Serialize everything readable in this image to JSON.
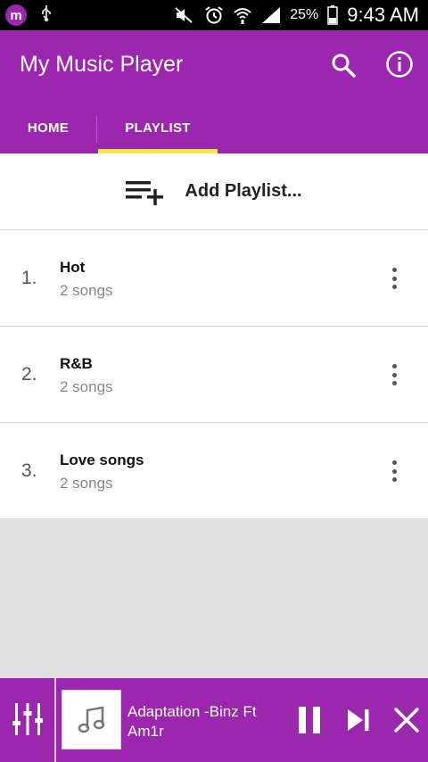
{
  "status_bar": {
    "app_badge": "m",
    "battery_percent": "25%",
    "time": "9:43 AM",
    "icons": [
      "app-badge",
      "usb-icon",
      "mute-icon",
      "alarm-icon",
      "wifi-icon",
      "signal-icon",
      "battery-icon"
    ]
  },
  "app_bar": {
    "title": "My Music Player",
    "icons": [
      "search-icon",
      "info-icon"
    ],
    "tabs": [
      {
        "label": "HOME",
        "selected": false
      },
      {
        "label": "PLAYLIST",
        "selected": true
      }
    ],
    "accent_color": "#9b27af",
    "indicator_color": "#f7e94a"
  },
  "add_playlist": {
    "label": "Add Playlist...",
    "icon": "playlist-add-icon"
  },
  "playlists": [
    {
      "number": "1.",
      "name": "Hot",
      "count": "2 songs"
    },
    {
      "number": "2.",
      "name": "R&B",
      "count": "2 songs"
    },
    {
      "number": "3.",
      "name": "Love songs",
      "count": "2 songs"
    }
  ],
  "player": {
    "track_title": "Adaptation -Binz Ft Am1r",
    "icons": [
      "equalizer-icon",
      "music-note-icon",
      "pause-icon",
      "skip-next-icon",
      "close-icon"
    ]
  }
}
